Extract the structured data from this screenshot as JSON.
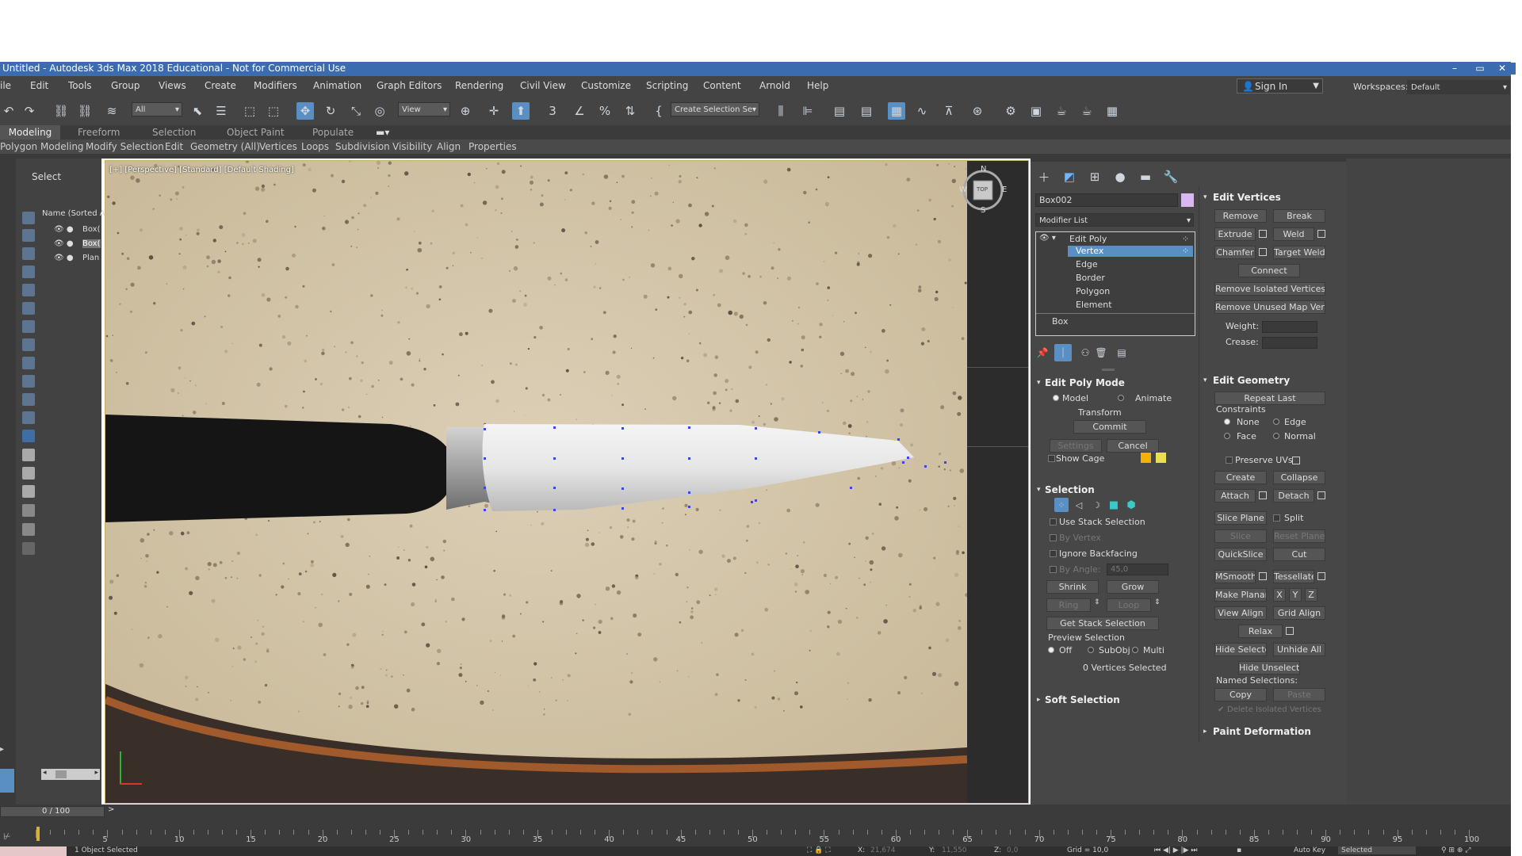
{
  "window": {
    "title": "Untitled - Autodesk 3ds Max 2018 Educational - Not for Commercial Use"
  },
  "menu": [
    "ile",
    "Edit",
    "Tools",
    "Group",
    "Views",
    "Create",
    "Modifiers",
    "Animation",
    "Graph Editors",
    "Rendering",
    "Civil View",
    "Customize",
    "Scripting",
    "Content",
    "Arnold",
    "Help"
  ],
  "toolbar": {
    "filter_value": "All",
    "refcoord_value": "View",
    "selection_set_placeholder": "Create Selection Se"
  },
  "account": {
    "signin_label": "Sign In",
    "workspaces_label": "Workspaces:",
    "workspace_value": "Default"
  },
  "ribbon_tabs": [
    "Modeling",
    "Freeform",
    "Selection",
    "Object Paint",
    "Populate"
  ],
  "ribbon_panels": [
    "Polygon Modeling",
    "Modify Selection",
    "Edit",
    "Geometry (All)",
    "Vertices",
    "Loops",
    "Subdivision",
    "Visibility",
    "Align",
    "Properties"
  ],
  "scene_explorer": {
    "select_label": "Select",
    "column_header": "Name (Sorted A",
    "items": [
      "Box(",
      "Box(",
      "Plan"
    ]
  },
  "viewport": {
    "label": "[+] [Perspective] [Standard] [Default Shading]",
    "viewcube": {
      "n": "N",
      "s": "S",
      "w": "W",
      "e": "E",
      "face": "TOP"
    }
  },
  "command_panel": {
    "object_name": "Box002",
    "object_color": "#d8b7f2",
    "modifier_list_label": "Modifier List",
    "stack": {
      "edit_poly": "Edit Poly",
      "subobjects": [
        "Vertex",
        "Edge",
        "Border",
        "Polygon",
        "Element"
      ],
      "base": "Box"
    },
    "edit_poly_mode": {
      "header": "Edit Poly Mode",
      "model": "Model",
      "animate": "Animate",
      "transform": "Transform",
      "commit": "Commit",
      "settings": "Settings",
      "cancel": "Cancel",
      "show_cage": "Show Cage",
      "cage_colors": [
        "#f2b300",
        "#e8e050"
      ]
    },
    "selection": {
      "header": "Selection",
      "use_stack": "Use Stack Selection",
      "by_vertex": "By Vertex",
      "ignore_backfacing": "Ignore Backfacing",
      "by_angle": "By Angle:",
      "angle_value": "45,0",
      "shrink": "Shrink",
      "grow": "Grow",
      "ring": "Ring",
      "loop": "Loop",
      "get_stack": "Get Stack Selection",
      "preview": "Preview Selection",
      "off": "Off",
      "subobj": "SubObj",
      "multi": "Multi",
      "status": "0 Vertices Selected"
    },
    "soft_selection": "Soft Selection",
    "edit_vertices": {
      "header": "Edit Vertices",
      "remove": "Remove",
      "break": "Break",
      "extrude": "Extrude",
      "weld": "Weld",
      "chamfer": "Chamfer",
      "target_weld": "Target Weld",
      "connect": "Connect",
      "remove_isolated": "Remove Isolated Vertices",
      "remove_unused": "Remove Unused Map Verts",
      "weight": "Weight:",
      "crease": "Crease:"
    },
    "edit_geometry": {
      "header": "Edit Geometry",
      "repeat_last": "Repeat Last",
      "constraints": "Constraints",
      "none": "None",
      "edge": "Edge",
      "face": "Face",
      "normal": "Normal",
      "preserve_uvs": "Preserve UVs",
      "create": "Create",
      "collapse": "Collapse",
      "attach": "Attach",
      "detach": "Detach",
      "slice_plane": "Slice Plane",
      "split": "Split",
      "slice": "Slice",
      "reset_plane": "Reset Plane",
      "quickslice": "QuickSlice",
      "cut": "Cut",
      "msmooth": "MSmooth",
      "tessellate": "Tessellate",
      "make_planar": "Make Planar",
      "x": "X",
      "y": "Y",
      "z": "Z",
      "view_align": "View Align",
      "grid_align": "Grid Align",
      "relax": "Relax",
      "hide_selected": "Hide Selected",
      "unhide_all": "Unhide All",
      "hide_unselected": "Hide Unselected",
      "named_selections": "Named Selections:",
      "copy": "Copy",
      "paste": "Paste",
      "delete_isolated": "Delete Isolated Vertices"
    },
    "paint_deformation": "Paint Deformation"
  },
  "timeline": {
    "frame_label": "0 / 100",
    "ticks": [
      "5",
      "10",
      "15",
      "20",
      "25",
      "30",
      "35",
      "40",
      "45",
      "50",
      "55",
      "60",
      "65",
      "70",
      "75",
      "80",
      "85",
      "90",
      "95",
      "100"
    ]
  },
  "statusbar": {
    "selected_text": "1 Object Selected",
    "x_label": "X:",
    "x_value": "21,674",
    "y_label": "Y:",
    "y_value": "11,550",
    "z_label": "Z:",
    "z_value": "0,0",
    "grid": "Grid = 10,0",
    "autokey": "Auto Key",
    "selected_dd": "Selected"
  }
}
